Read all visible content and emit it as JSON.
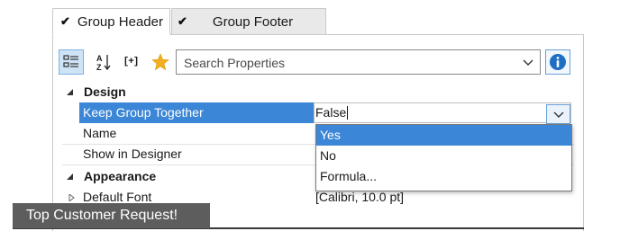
{
  "tabs": [
    {
      "check": "✔",
      "label": "Group Header",
      "active": true
    },
    {
      "check": "✔",
      "label": "Group Footer",
      "active": false
    }
  ],
  "toolbar": {
    "add_label": "[+]",
    "search_placeholder": "Search Properties"
  },
  "grid": {
    "categories": [
      {
        "label": "Design"
      },
      {
        "label": "Appearance"
      }
    ],
    "properties": [
      {
        "name": "Keep Group Together",
        "value": "False"
      },
      {
        "name": "Name",
        "value": ""
      },
      {
        "name": "Show in Designer",
        "value": ""
      },
      {
        "name": "Default Font",
        "value": "[Calibri, 10.0 pt]"
      }
    ]
  },
  "dropdown": {
    "options": [
      "Yes",
      "No",
      "Formula..."
    ],
    "highlighted": "Yes"
  },
  "badge": {
    "text": "Top Customer Request!"
  },
  "colors": {
    "selection": "#3b86d6",
    "info": "#1e6fc4",
    "star": "#f2b01e",
    "badge": "#5d5d5d"
  }
}
